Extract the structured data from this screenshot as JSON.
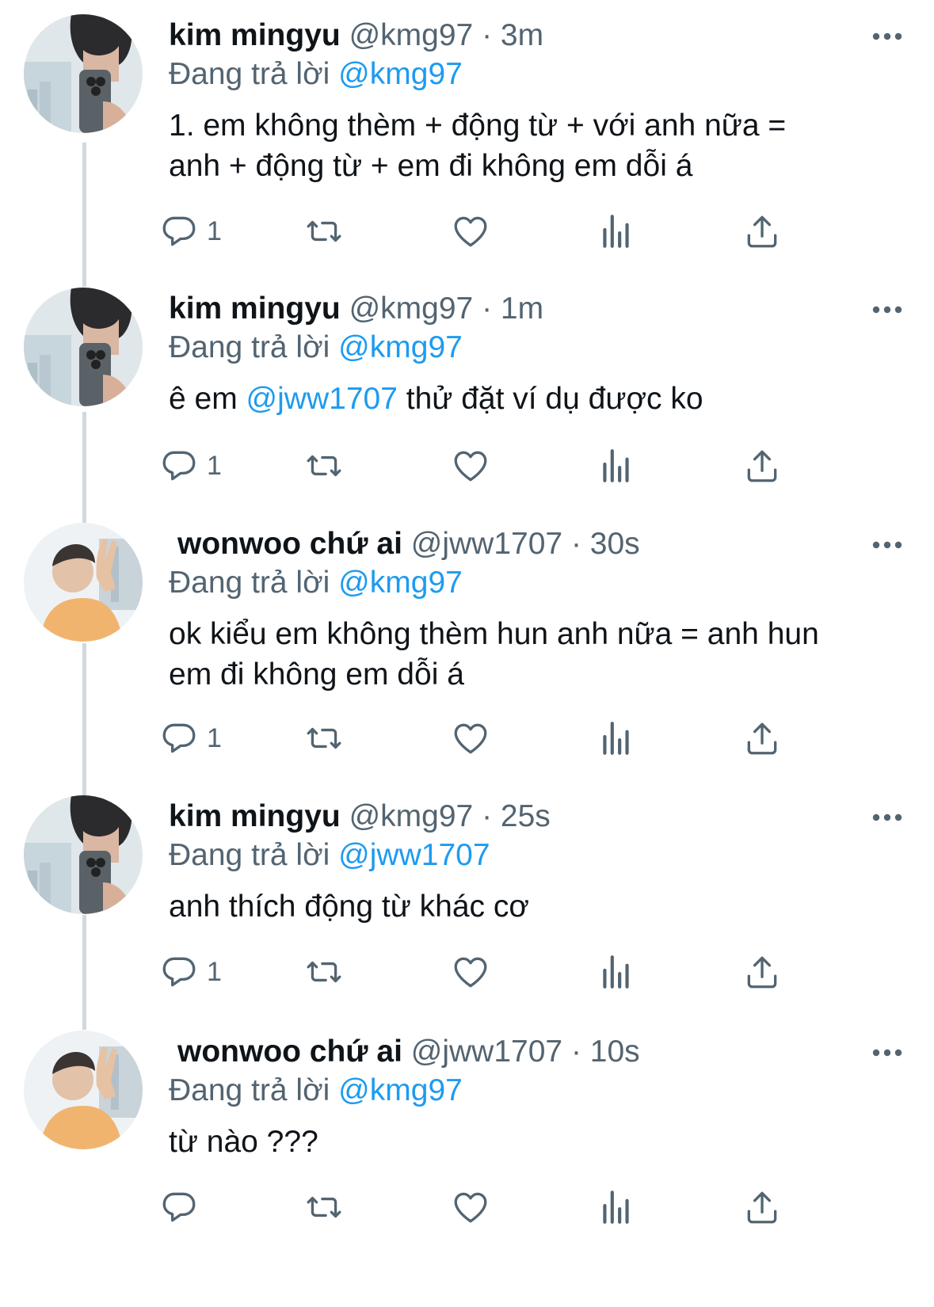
{
  "colors": {
    "accent": "#1d9bf0",
    "secondary": "#536471",
    "thread": "#cfd9de"
  },
  "icons": [
    "reply-icon",
    "retweet-icon",
    "like-icon",
    "views-icon",
    "share-icon",
    "more-icon"
  ],
  "tweets": [
    {
      "name": "kim mingyu",
      "handle": "@kmg97",
      "dot": "·",
      "time": "3m",
      "reply_prefix": "Đang trả lời",
      "reply_to": "@kmg97",
      "text_lines": [
        "1. em không thèm + động từ + với anh nữa =",
        "anh + động từ + em đi không em dỗi á"
      ],
      "reply_count": "1"
    },
    {
      "name": "kim mingyu",
      "handle": "@kmg97",
      "dot": "·",
      "time": "1m",
      "reply_prefix": "Đang trả lời",
      "reply_to": "@kmg97",
      "text_before": "ê em",
      "text_mention": "@jww1707",
      "text_after": "thử đặt ví dụ được ko",
      "reply_count": "1"
    },
    {
      "name": "wonwoo chứ ai",
      "handle": "@jww1707",
      "dot": "·",
      "time": "30s",
      "reply_prefix": "Đang trả lời",
      "reply_to": "@kmg97",
      "text_lines": [
        "ok kiểu em không thèm hun anh nữa = anh hun",
        "em đi không em dỗi á"
      ],
      "reply_count": "1"
    },
    {
      "name": "kim mingyu",
      "handle": "@kmg97",
      "dot": "·",
      "time": "25s",
      "reply_prefix": "Đang trả lời",
      "reply_to": "@jww1707",
      "text_lines": [
        "anh thích động từ khác cơ"
      ],
      "reply_count": "1"
    },
    {
      "name": "wonwoo chứ ai",
      "handle": "@jww1707",
      "dot": "·",
      "time": "10s",
      "reply_prefix": "Đang trả lời",
      "reply_to": "@kmg97",
      "text_lines": [
        "từ nào ???"
      ],
      "reply_count": ""
    }
  ]
}
